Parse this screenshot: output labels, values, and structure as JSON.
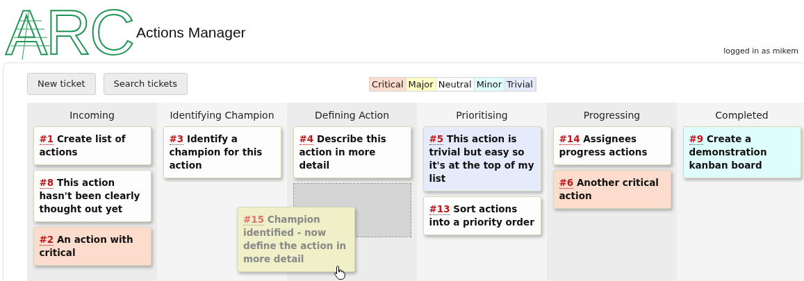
{
  "header": {
    "logo": "ARC",
    "title": "Actions Manager",
    "user": "logged in as mikem"
  },
  "buttons": [
    "New ticket",
    "Search tickets"
  ],
  "legend": [
    {
      "label": "Critical",
      "color": "#fcdccc"
    },
    {
      "label": "Major",
      "color": "#fdfdc4"
    },
    {
      "label": "Neutral",
      "color": "#fdfdfd"
    },
    {
      "label": "Minor",
      "color": "#e0fdfd"
    },
    {
      "label": "Trivial",
      "color": "#e5ebfb"
    }
  ],
  "columns": [
    {
      "title": "Incoming",
      "drop_slot": false,
      "cards": [
        {
          "id": "#1",
          "title": "Create list of actions",
          "color": "#fdfdfd"
        },
        {
          "id": "#8",
          "title": "This action hasn't been clearly thought out yet",
          "color": "#fdfdfd"
        },
        {
          "id": "#2",
          "title": "An action with critical",
          "color": "#fcdccc"
        }
      ]
    },
    {
      "title": "Identifying Champion",
      "drop_slot": false,
      "cards": [
        {
          "id": "#3",
          "title": "Identify a champion for this action",
          "color": "#fdfdfd"
        }
      ]
    },
    {
      "title": "Defining Action",
      "drop_slot": true,
      "cards": [
        {
          "id": "#4",
          "title": "Describe this action in more detail",
          "color": "#fdfdfd"
        }
      ]
    },
    {
      "title": "Prioritising",
      "drop_slot": false,
      "cards": [
        {
          "id": "#5",
          "title": "This action is trivial but easy so it's at the top of my list",
          "color": "#e5ebfb"
        },
        {
          "id": "#13",
          "title": "Sort actions into a priority order",
          "color": "#fdfdfd"
        }
      ]
    },
    {
      "title": "Progressing",
      "drop_slot": false,
      "cards": [
        {
          "id": "#14",
          "title": "Assignees progress actions",
          "color": "#fdfdfd"
        },
        {
          "id": "#6",
          "title": "Another critical action",
          "color": "#fcdccc"
        }
      ]
    },
    {
      "title": "Completed",
      "drop_slot": false,
      "cards": [
        {
          "id": "#9",
          "title": "Create a demonstration kanban board",
          "color": "#e0fdfd"
        }
      ]
    }
  ],
  "dragging": {
    "id": "#15",
    "title": "Champion identified - now define the action in more detail",
    "color": "#efefc8"
  }
}
